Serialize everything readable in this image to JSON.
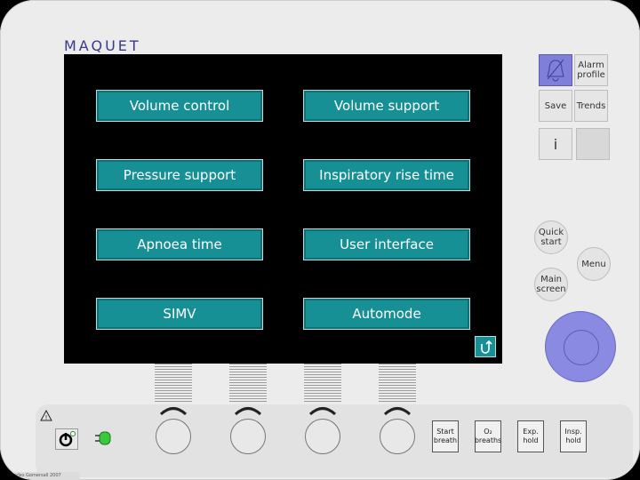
{
  "brand": "MAQUET",
  "menu": {
    "items": [
      "Volume control",
      "Volume support",
      "Pressure support",
      "Inspiratory rise time",
      "Apnoea time",
      "User interface",
      "SIMV",
      "Automode"
    ]
  },
  "side": {
    "alarm_profile": "Alarm profile",
    "save": "Save",
    "trends": "Trends",
    "info": "i",
    "quick_start": "Quick start",
    "menu": "Menu",
    "main_screen": "Main screen"
  },
  "panel": {
    "start_breath": "Start breath",
    "o2_breaths": "O₂ breaths",
    "exp_hold": "Exp. hold",
    "insp_hold": "Insp. hold",
    "warning": "!"
  },
  "copyright": "© Charles Gomersall 2007",
  "colors": {
    "menu_button": "#168f95",
    "knob": "#8a8ae2",
    "alarm_button": "#7f7fd9"
  }
}
